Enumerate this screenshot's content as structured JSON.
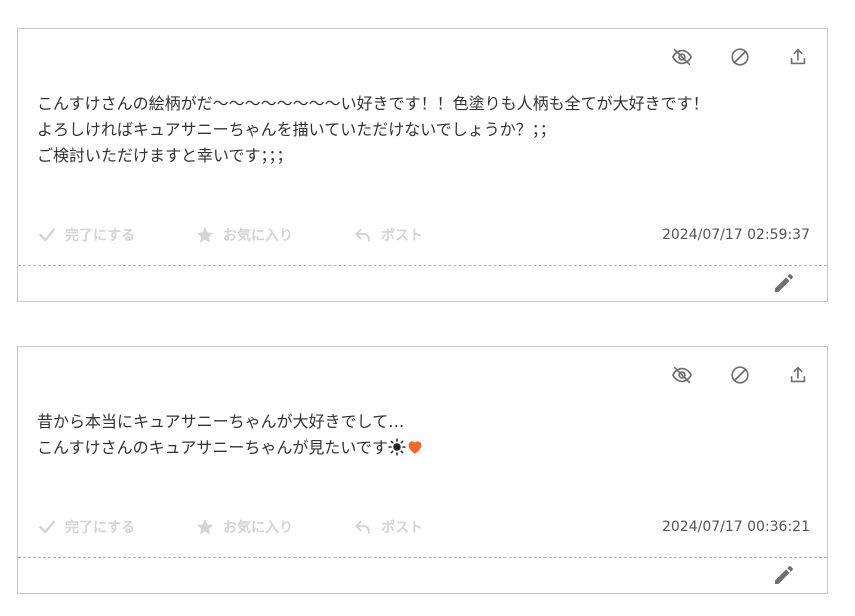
{
  "colors": {
    "icon_gray": "#6f6f6f",
    "action_disabled": "#d4d4d4",
    "text": "#333333",
    "timestamp": "#555555",
    "heart": "#f26a21",
    "border": "#c8c8c8"
  },
  "top_icons": [
    "eye-slash-icon",
    "block-icon",
    "upload-icon"
  ],
  "actions": {
    "complete_label": "完了にする",
    "favorite_label": "お気に入り",
    "post_label": "ポスト"
  },
  "cards": [
    {
      "lines": [
        "こんすけさんの絵柄がだ〜〜〜〜〜〜〜〜い好きです！！色塗りも人柄も全てが大好きです！",
        "よろしければキュアサニーちゃんを描いていただけないでしょうか？；；",
        "ご検討いただけますと幸いです；；；"
      ],
      "timestamp": "2024/07/17 02:59:37"
    },
    {
      "lines": [
        "昔から本当にキュアサニーちゃんが大好きでして…",
        "こんすけさんのキュアサニーちゃんが見たいです"
      ],
      "emojis": [
        "sun-emoji",
        "orange-heart-emoji"
      ],
      "timestamp": "2024/07/17 00:36:21"
    }
  ]
}
